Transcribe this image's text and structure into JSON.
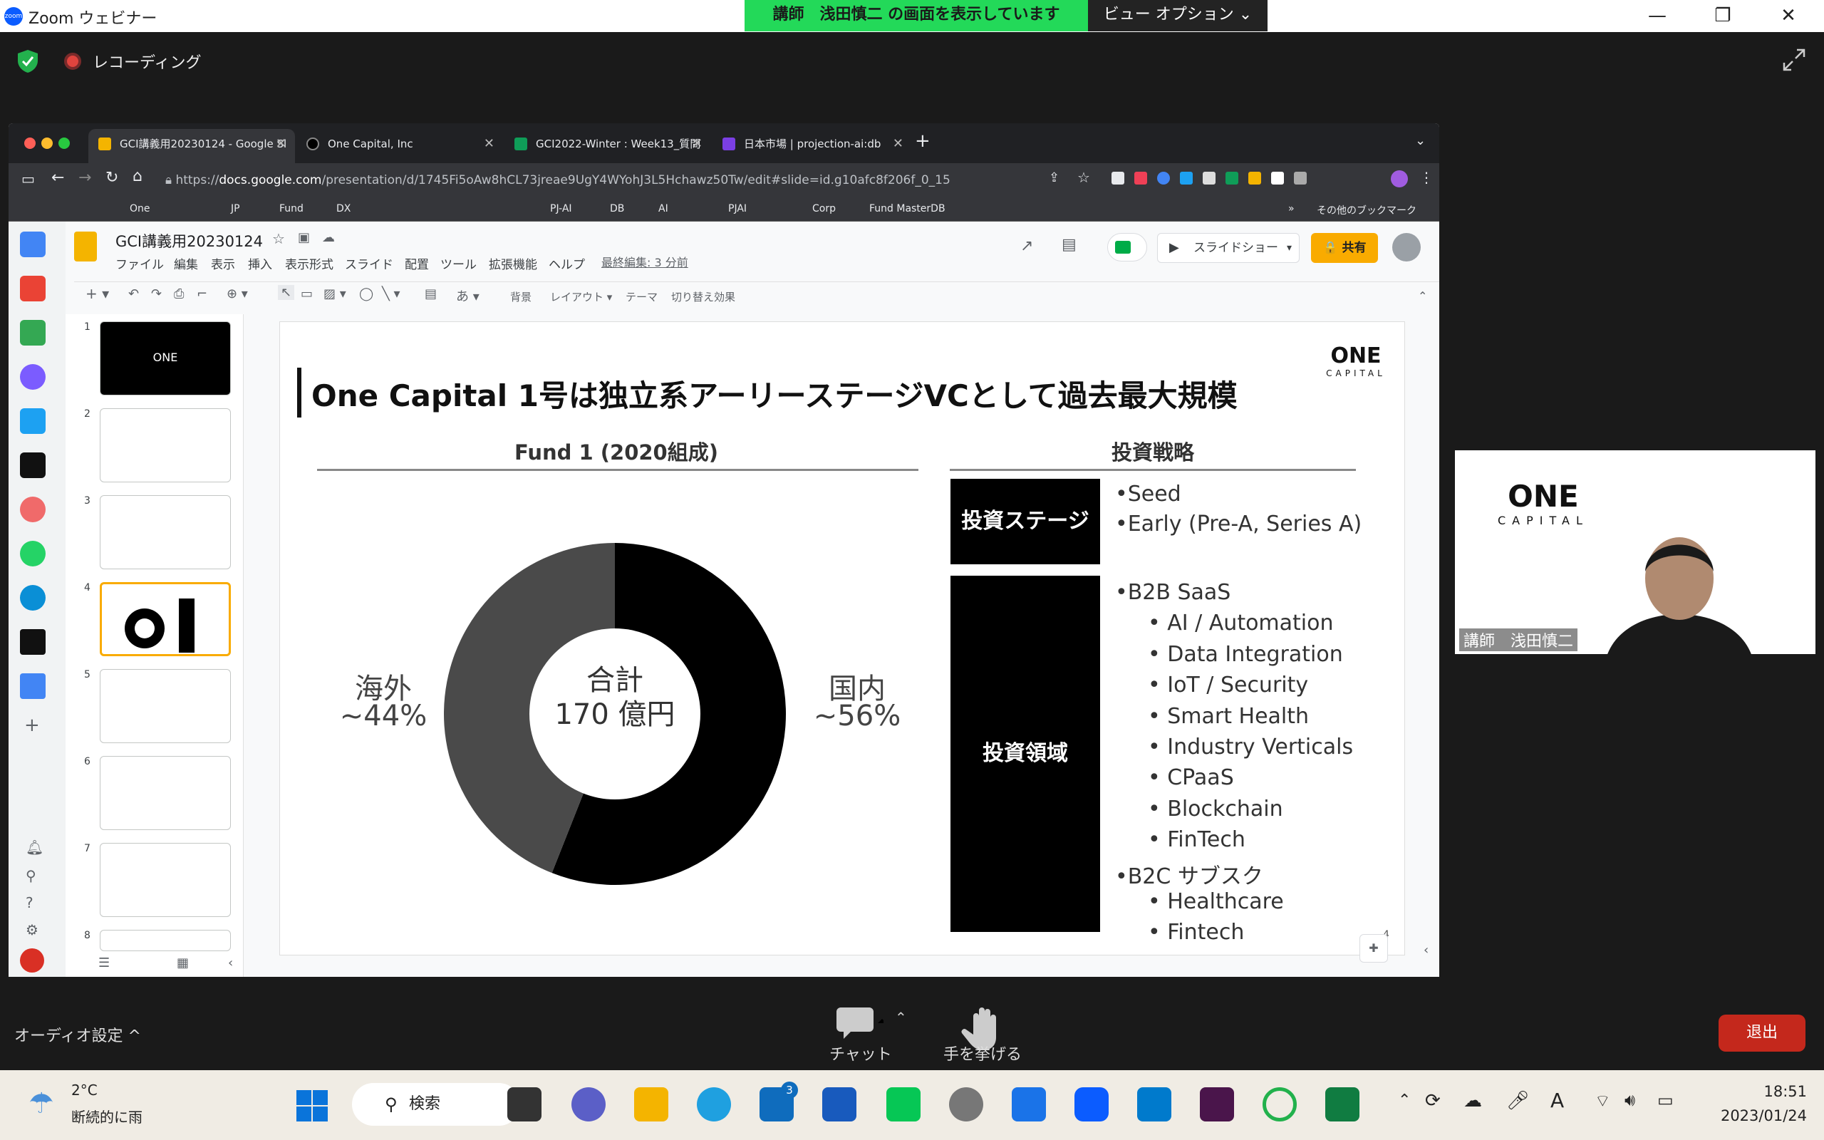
{
  "zoom": {
    "window_title": "Zoom ウェビナー",
    "logo_text": "zoom",
    "share_banner": "講師　浅田慎二 の画面を表示しています",
    "view_options": "ビュー オプション ⌄",
    "recording_label": "レコーディング",
    "audio_settings": "オーディオ設定  ^",
    "chat_label": "チャット",
    "raise_hand_label": "手を挙げる",
    "leave_button": "退出",
    "presenter_name": "講師　浅田慎二",
    "colors": {
      "banner": "#23d959",
      "leave": "#c4281c"
    }
  },
  "browser": {
    "tabs": [
      {
        "title": "GCI講義用20230124 - Google Sl",
        "active": true
      },
      {
        "title": "One Capital, Inc",
        "active": false
      },
      {
        "title": "GCI2022-Winter : Week13_質問",
        "active": false
      },
      {
        "title": "日本市場 | projection-ai:db",
        "active": false
      }
    ],
    "new_tab": "+",
    "url_prefix": "https://",
    "url_host": "docs.google.com",
    "url_path": "/presentation/d/1745Fi5oAw8hCL73jreae9UgY4WYohJ3L5Hchawz50Tw/edit#slide=id.g10afc8f206f_0_15",
    "bookmarks": [
      "One",
      "JP",
      "Fund",
      "DX",
      "PJ-AI",
      "DB",
      "AI",
      "PJAI",
      "Corp",
      "Fund MasterDB",
      "»",
      "その他のブックマーク"
    ]
  },
  "slides_app": {
    "doc_title": "GCI講義用20230124",
    "menus": [
      "ファイル",
      "編集",
      "表示",
      "挿入",
      "表示形式",
      "スライド",
      "配置",
      "ツール",
      "拡張機能",
      "ヘルプ"
    ],
    "last_edit": "最終編集: 3 分前",
    "slideshow_button": "スライドショー",
    "share_button": "🔒 共有",
    "toolbar_items": [
      "背景",
      "レイアウト ▾",
      "テーマ",
      "切り替え効果"
    ],
    "slide_numbers": [
      "1",
      "2",
      "3",
      "4",
      "5",
      "6",
      "7",
      "8"
    ]
  },
  "slide": {
    "title": "One Capital 1号は独立系アーリーステージVCとして過去最大規模",
    "logo_top": "ONE",
    "logo_bottom": "CAPITAL",
    "fund_header": "Fund 1 (2020組成)",
    "strategy_header": "投資戦略",
    "total_label": "合計",
    "total_value": "170 億円",
    "overseas_label": "海外",
    "overseas_pct": "~44%",
    "domestic_label": "国内",
    "domestic_pct": "~56%",
    "stage_box": "投資ステージ",
    "domain_box": "投資領域",
    "stage_items": [
      "•Seed",
      "•Early (Pre-A, Series A)"
    ],
    "domain_items": [
      {
        "text": "•B2B SaaS",
        "level": 0
      },
      {
        "text": "•  AI / Automation",
        "level": 1
      },
      {
        "text": "•  Data Integration",
        "level": 1
      },
      {
        "text": "•  IoT / Security",
        "level": 1
      },
      {
        "text": "•  Smart Health",
        "level": 1
      },
      {
        "text": "•  Industry Verticals",
        "level": 1
      },
      {
        "text": "•  CPaaS",
        "level": 1
      },
      {
        "text": "•  Blockchain",
        "level": 1
      },
      {
        "text": "•  FinTech",
        "level": 1
      },
      {
        "text": "•B2C サブスク",
        "level": 0
      },
      {
        "text": "•  Healthcare",
        "level": 1
      },
      {
        "text": "•  Fintech",
        "level": 1
      }
    ],
    "page_number": "4"
  },
  "chart_data": {
    "type": "pie",
    "categories": [
      "国内",
      "海外"
    ],
    "values": [
      56,
      44
    ],
    "colors": [
      "#000000",
      "#4a4a4a"
    ]
  },
  "taskbar": {
    "weather_temp": "2°C",
    "weather_desc": "断続的に雨",
    "search_label": "検索",
    "mail_badge": "3",
    "time": "18:51",
    "date": "2023/01/24"
  }
}
